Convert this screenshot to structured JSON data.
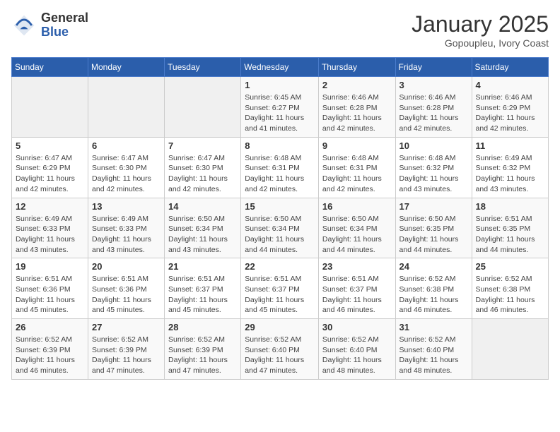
{
  "header": {
    "logo": {
      "general": "General",
      "blue": "Blue"
    },
    "title": "January 2025",
    "location": "Gopoupleu, Ivory Coast"
  },
  "weekdays": [
    "Sunday",
    "Monday",
    "Tuesday",
    "Wednesday",
    "Thursday",
    "Friday",
    "Saturday"
  ],
  "weeks": [
    [
      {
        "day": "",
        "sunrise": "",
        "sunset": "",
        "daylight": ""
      },
      {
        "day": "",
        "sunrise": "",
        "sunset": "",
        "daylight": ""
      },
      {
        "day": "",
        "sunrise": "",
        "sunset": "",
        "daylight": ""
      },
      {
        "day": "1",
        "sunrise": "6:45 AM",
        "sunset": "6:27 PM",
        "daylight": "11 hours and 41 minutes."
      },
      {
        "day": "2",
        "sunrise": "6:46 AM",
        "sunset": "6:28 PM",
        "daylight": "11 hours and 42 minutes."
      },
      {
        "day": "3",
        "sunrise": "6:46 AM",
        "sunset": "6:28 PM",
        "daylight": "11 hours and 42 minutes."
      },
      {
        "day": "4",
        "sunrise": "6:46 AM",
        "sunset": "6:29 PM",
        "daylight": "11 hours and 42 minutes."
      }
    ],
    [
      {
        "day": "5",
        "sunrise": "6:47 AM",
        "sunset": "6:29 PM",
        "daylight": "11 hours and 42 minutes."
      },
      {
        "day": "6",
        "sunrise": "6:47 AM",
        "sunset": "6:30 PM",
        "daylight": "11 hours and 42 minutes."
      },
      {
        "day": "7",
        "sunrise": "6:47 AM",
        "sunset": "6:30 PM",
        "daylight": "11 hours and 42 minutes."
      },
      {
        "day": "8",
        "sunrise": "6:48 AM",
        "sunset": "6:31 PM",
        "daylight": "11 hours and 42 minutes."
      },
      {
        "day": "9",
        "sunrise": "6:48 AM",
        "sunset": "6:31 PM",
        "daylight": "11 hours and 42 minutes."
      },
      {
        "day": "10",
        "sunrise": "6:48 AM",
        "sunset": "6:32 PM",
        "daylight": "11 hours and 43 minutes."
      },
      {
        "day": "11",
        "sunrise": "6:49 AM",
        "sunset": "6:32 PM",
        "daylight": "11 hours and 43 minutes."
      }
    ],
    [
      {
        "day": "12",
        "sunrise": "6:49 AM",
        "sunset": "6:33 PM",
        "daylight": "11 hours and 43 minutes."
      },
      {
        "day": "13",
        "sunrise": "6:49 AM",
        "sunset": "6:33 PM",
        "daylight": "11 hours and 43 minutes."
      },
      {
        "day": "14",
        "sunrise": "6:50 AM",
        "sunset": "6:34 PM",
        "daylight": "11 hours and 43 minutes."
      },
      {
        "day": "15",
        "sunrise": "6:50 AM",
        "sunset": "6:34 PM",
        "daylight": "11 hours and 44 minutes."
      },
      {
        "day": "16",
        "sunrise": "6:50 AM",
        "sunset": "6:34 PM",
        "daylight": "11 hours and 44 minutes."
      },
      {
        "day": "17",
        "sunrise": "6:50 AM",
        "sunset": "6:35 PM",
        "daylight": "11 hours and 44 minutes."
      },
      {
        "day": "18",
        "sunrise": "6:51 AM",
        "sunset": "6:35 PM",
        "daylight": "11 hours and 44 minutes."
      }
    ],
    [
      {
        "day": "19",
        "sunrise": "6:51 AM",
        "sunset": "6:36 PM",
        "daylight": "11 hours and 45 minutes."
      },
      {
        "day": "20",
        "sunrise": "6:51 AM",
        "sunset": "6:36 PM",
        "daylight": "11 hours and 45 minutes."
      },
      {
        "day": "21",
        "sunrise": "6:51 AM",
        "sunset": "6:37 PM",
        "daylight": "11 hours and 45 minutes."
      },
      {
        "day": "22",
        "sunrise": "6:51 AM",
        "sunset": "6:37 PM",
        "daylight": "11 hours and 45 minutes."
      },
      {
        "day": "23",
        "sunrise": "6:51 AM",
        "sunset": "6:37 PM",
        "daylight": "11 hours and 46 minutes."
      },
      {
        "day": "24",
        "sunrise": "6:52 AM",
        "sunset": "6:38 PM",
        "daylight": "11 hours and 46 minutes."
      },
      {
        "day": "25",
        "sunrise": "6:52 AM",
        "sunset": "6:38 PM",
        "daylight": "11 hours and 46 minutes."
      }
    ],
    [
      {
        "day": "26",
        "sunrise": "6:52 AM",
        "sunset": "6:39 PM",
        "daylight": "11 hours and 46 minutes."
      },
      {
        "day": "27",
        "sunrise": "6:52 AM",
        "sunset": "6:39 PM",
        "daylight": "11 hours and 47 minutes."
      },
      {
        "day": "28",
        "sunrise": "6:52 AM",
        "sunset": "6:39 PM",
        "daylight": "11 hours and 47 minutes."
      },
      {
        "day": "29",
        "sunrise": "6:52 AM",
        "sunset": "6:40 PM",
        "daylight": "11 hours and 47 minutes."
      },
      {
        "day": "30",
        "sunrise": "6:52 AM",
        "sunset": "6:40 PM",
        "daylight": "11 hours and 48 minutes."
      },
      {
        "day": "31",
        "sunrise": "6:52 AM",
        "sunset": "6:40 PM",
        "daylight": "11 hours and 48 minutes."
      },
      {
        "day": "",
        "sunrise": "",
        "sunset": "",
        "daylight": ""
      }
    ]
  ]
}
